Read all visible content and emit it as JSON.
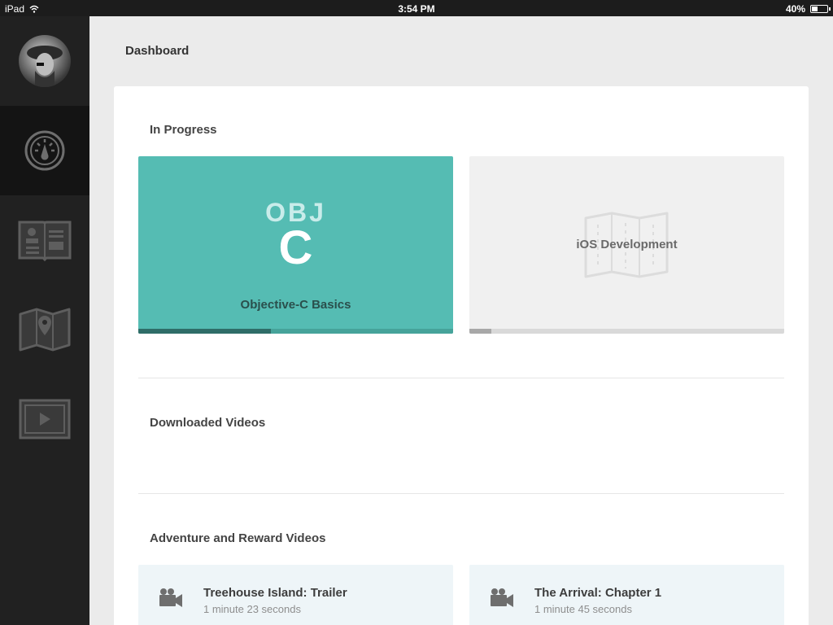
{
  "status_bar": {
    "device": "iPad",
    "time": "3:54 PM",
    "battery": "40%",
    "battery_level": 0.4
  },
  "sidebar": {
    "items": [
      {
        "icon": "dashboard-gauge-icon",
        "active": true
      },
      {
        "icon": "library-book-icon",
        "active": false
      },
      {
        "icon": "tracks-map-icon",
        "active": false
      },
      {
        "icon": "video-play-icon",
        "active": false
      }
    ]
  },
  "page": {
    "title": "Dashboard"
  },
  "in_progress": {
    "title": "In Progress",
    "courses": [
      {
        "logo_top": "OBJ",
        "logo_bottom": "C",
        "title": "Objective-C Basics",
        "progress": 0.42,
        "color": "#55bcb3"
      },
      {
        "title": "iOS Development",
        "progress": 0.07,
        "color": "#f0f0f0"
      }
    ]
  },
  "downloaded_videos": {
    "title": "Downloaded Videos"
  },
  "adventure_videos": {
    "title": "Adventure and Reward Videos",
    "items": [
      {
        "title": "Treehouse Island: Trailer",
        "duration": "1 minute 23 seconds"
      },
      {
        "title": "The Arrival: Chapter 1",
        "duration": "1 minute 45 seconds"
      }
    ]
  }
}
